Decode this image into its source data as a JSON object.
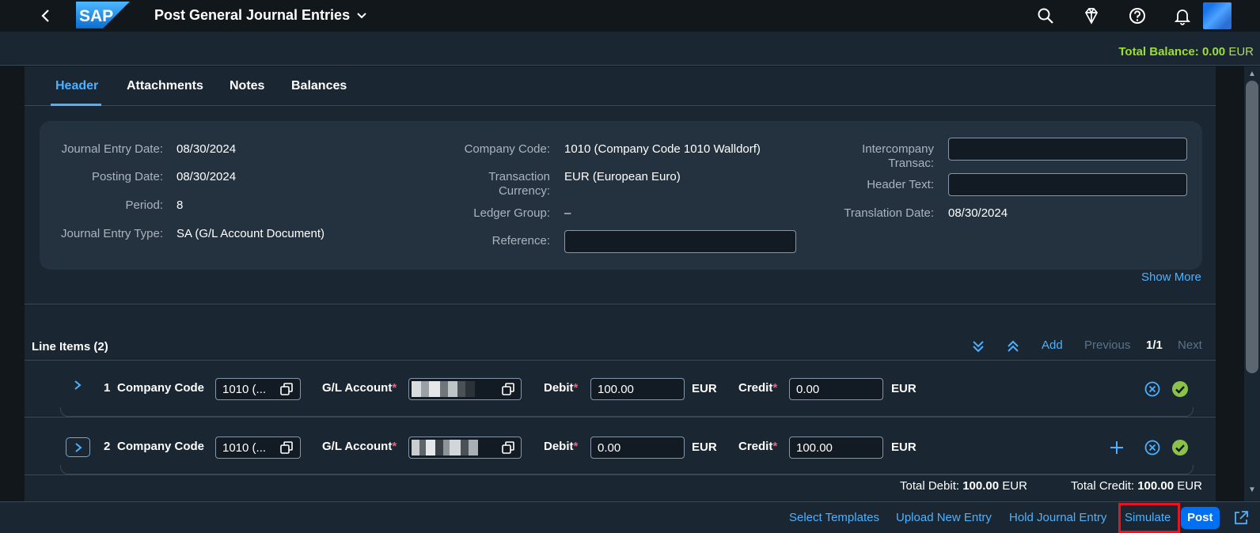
{
  "shell": {
    "title": "Post General Journal Entries",
    "logo_text": "SAP",
    "icons": [
      "back-icon",
      "search-icon",
      "diamond-icon",
      "help-icon",
      "bell-icon"
    ]
  },
  "balance": {
    "label": "Total Balance:",
    "value": "0.00",
    "currency": "EUR"
  },
  "tabs": [
    {
      "label": "Header"
    },
    {
      "label": "Attachments"
    },
    {
      "label": "Notes"
    },
    {
      "label": "Balances"
    }
  ],
  "header": {
    "journal_entry_date_label": "Journal Entry Date:",
    "journal_entry_date": "08/30/2024",
    "posting_date_label": "Posting Date:",
    "posting_date": "08/30/2024",
    "period_label": "Period:",
    "period": "8",
    "journal_entry_type_label": "Journal Entry Type:",
    "journal_entry_type": "SA (G/L Account Document)",
    "company_code_label": "Company Code:",
    "company_code": "1010 (Company Code 1010 Walldorf)",
    "transaction_currency_label_1": "Transaction",
    "transaction_currency_label_2": "Currency:",
    "transaction_currency": "EUR (European Euro)",
    "ledger_group_label": "Ledger Group:",
    "ledger_group": "–",
    "reference_label": "Reference:",
    "reference": "",
    "intercompany_label_1": "Intercompany",
    "intercompany_label_2": "Transac:",
    "intercompany": "",
    "header_text_label": "Header Text:",
    "header_text": "",
    "translation_date_label": "Translation Date:",
    "translation_date": "08/30/2024",
    "show_more": "Show More"
  },
  "line_items": {
    "title": "Line Items (2)",
    "add": "Add",
    "previous": "Previous",
    "page": "1/1",
    "next": "Next",
    "labels": {
      "company_code": "Company Code",
      "gl_account": "G/L Account",
      "debit": "Debit",
      "credit": "Credit",
      "required": "*"
    },
    "rows": [
      {
        "num": "1",
        "company_code": "1010 (...",
        "debit": "100.00",
        "debit_cur": "EUR",
        "credit": "0.00",
        "credit_cur": "EUR"
      },
      {
        "num": "2",
        "company_code": "1010 (...",
        "debit": "0.00",
        "debit_cur": "EUR",
        "credit": "100.00",
        "credit_cur": "EUR"
      }
    ],
    "total_debit_label": "Total Debit:",
    "total_debit": "100.00",
    "total_debit_cur": "EUR",
    "total_credit_label": "Total Credit:",
    "total_credit": "100.00",
    "total_credit_cur": "EUR"
  },
  "footer": {
    "select_templates": "Select Templates",
    "upload_new_entry": "Upload New Entry",
    "hold_journal_entry": "Hold Journal Entry",
    "simulate": "Simulate",
    "post": "Post"
  },
  "colors": {
    "accent": "#4db1ff",
    "balance": "#9bdf2f",
    "emphasized": "#0070f2",
    "highlight": "#e8141f",
    "success": "#8bc34a"
  }
}
